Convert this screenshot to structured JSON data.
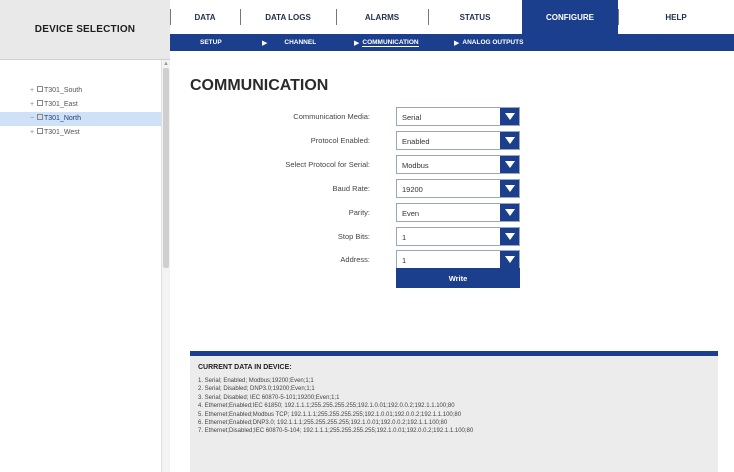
{
  "sidebar": {
    "title": "DEVICE SELECTION",
    "items": [
      {
        "expander": "+",
        "label": "T301_South",
        "selected": false
      },
      {
        "expander": "+",
        "label": "T301_East",
        "selected": false
      },
      {
        "expander": "−",
        "label": "T301_North",
        "selected": true
      },
      {
        "expander": "+",
        "label": "T301_West",
        "selected": false
      }
    ]
  },
  "tabs": [
    {
      "label": "DATA"
    },
    {
      "label": "DATA LOGS"
    },
    {
      "label": "ALARMS"
    },
    {
      "label": "STATUS"
    },
    {
      "label": "CONFIGURE",
      "active": true
    },
    {
      "label": "HELP"
    }
  ],
  "subnav": [
    {
      "label": "SETUP"
    },
    {
      "label": "CHANNEL"
    },
    {
      "label": "COMMUNICATION",
      "active": true
    },
    {
      "label": "ANALOG OUTPUTS"
    }
  ],
  "page": {
    "title": "COMMUNICATION",
    "fields": [
      {
        "label": "Communication Media:",
        "value": "Serial"
      },
      {
        "label": "Protocol Enabled:",
        "value": "Enabled"
      },
      {
        "label": "Select Protocol for Serial:",
        "value": "Modbus"
      },
      {
        "label": "Baud Rate:",
        "value": "19200"
      },
      {
        "label": "Parity:",
        "value": "Even"
      },
      {
        "label": "Stop Bits:",
        "value": "1"
      },
      {
        "label": "Address:",
        "value": "1"
      }
    ],
    "write_label": "Write"
  },
  "current_data": {
    "title": "CURRENT DATA IN DEVICE:",
    "lines": [
      "1. Serial; Enabled; Modbus;19200;Even;1;1",
      "2. Serial; Disabled; DNP3.0;19200;Even;1;1",
      "3. Serial; Disabled; IEC 60870-5-101;19200;Even;1;1",
      "4. Ethernet;Enabled;IEC 61850; 192.1.1.1;255.255.255.255;192.1.0.01;192.0.0.2;192.1.1.100;80",
      "5. Ethernet;Enabled;Modbus TCP; 192.1.1.1;255.255.255.255;192.1.0.01;192.0.0.2;192.1.1.100;80",
      "6. Ethernet;Enabled;DNP3.0; 192.1.1.1;255.255.255.255;192.1.0.01;192.0.0.2;192.1.1.100;80",
      "7. Ethernet;Disabled;IEC 60870-5-104; 192.1.1.1;255.255.255.255;192.1.0.01;192.0.0.2;192.1.1.100;80"
    ]
  },
  "colors": {
    "accent": "#1b3f8c",
    "selected_row": "#cfe1f6",
    "panel_bg": "#ececec"
  }
}
